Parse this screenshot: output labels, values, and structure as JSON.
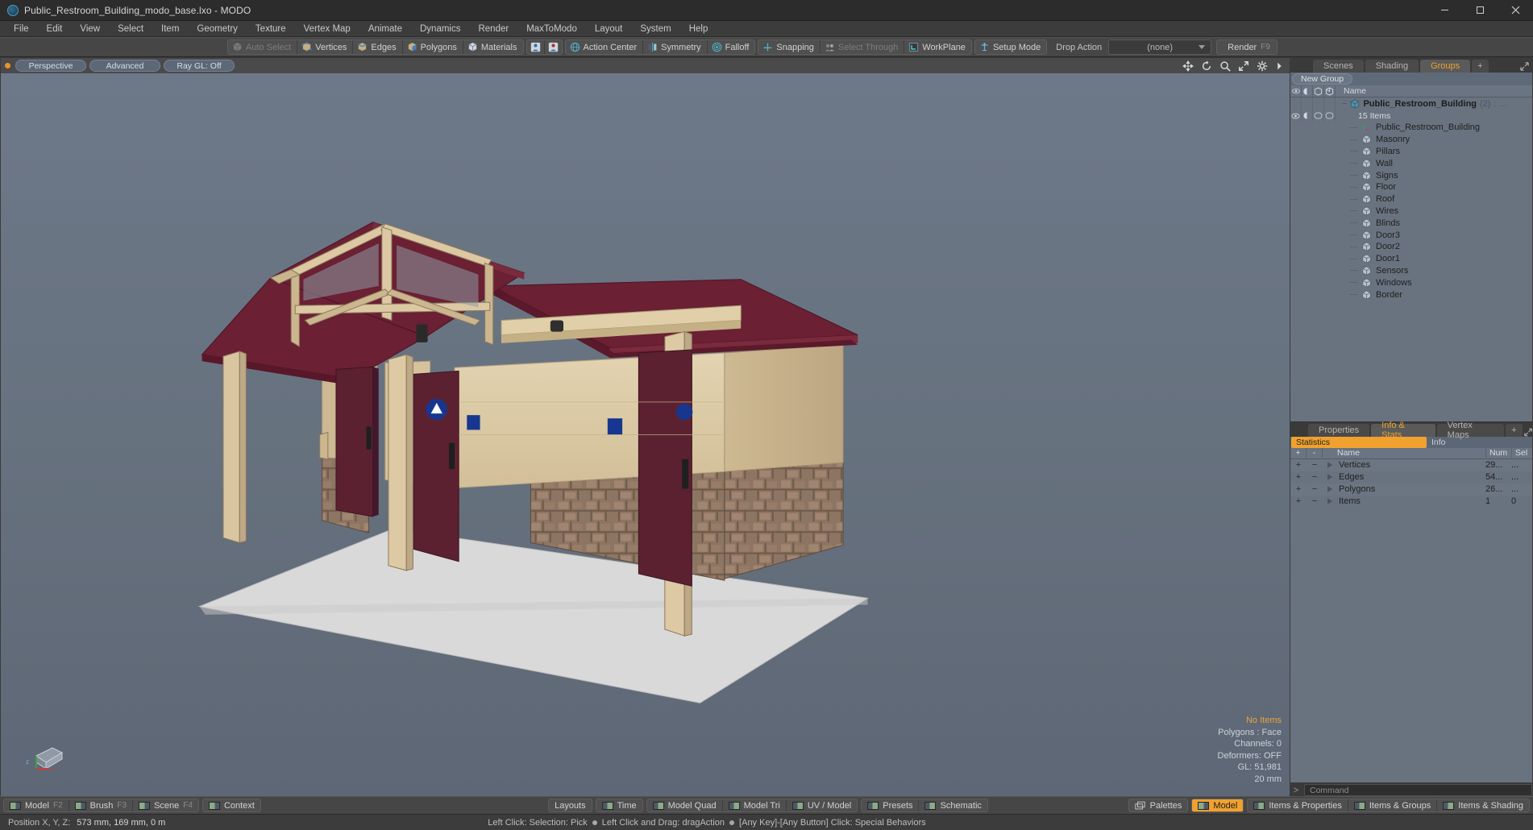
{
  "window": {
    "title": "Public_Restroom_Building_modo_base.lxo - MODO",
    "minimize": "minimize-icon",
    "maximize": "maximize-icon",
    "close": "close-icon"
  },
  "menubar": {
    "items": [
      "File",
      "Edit",
      "View",
      "Select",
      "Item",
      "Geometry",
      "Texture",
      "Vertex Map",
      "Animate",
      "Dynamics",
      "Render",
      "MaxToModo",
      "Layout",
      "System",
      "Help"
    ]
  },
  "toolbar": {
    "group1": [
      "Auto Select",
      "Vertices",
      "Edges",
      "Polygons",
      "Materials"
    ],
    "group2": [
      "Action Center",
      "Symmetry",
      "Falloff"
    ],
    "group3": [
      "Snapping",
      "Select Through",
      "WorkPlane"
    ],
    "group4": [
      "Setup Mode"
    ],
    "drop_action_label": "Drop Action",
    "drop_action_value": "(none)",
    "render_label": "Render",
    "render_key": "F9"
  },
  "viewport": {
    "tabs": [
      "Perspective",
      "Advanced",
      "Ray GL: Off"
    ],
    "corner_icons": [
      "pan-icon",
      "rotate-icon",
      "zoom-icon",
      "fit-icon",
      "gear-icon",
      "chevron-right-icon"
    ],
    "info": {
      "items": "No Items",
      "polygons": "Polygons : Face",
      "channels": "Channels: 0",
      "deformers": "Deformers: OFF",
      "gl": "GL: 51,981",
      "grid": "20 mm"
    },
    "axis": {
      "x": "x",
      "y": "y",
      "z": "z"
    }
  },
  "right_panel": {
    "tabs": [
      "Scenes",
      "Shading",
      "Groups"
    ],
    "active_tab": "Groups",
    "add_tab": "+",
    "new_group_button": "New Group",
    "name_column": "Name",
    "group": {
      "name": "Public_Restroom_Building",
      "count": "(2)",
      "trailing": ":",
      "ellipsis": "...",
      "subtitle": "15 Items"
    },
    "items": [
      {
        "label": "Public_Restroom_Building",
        "icon": "locator-icon"
      },
      {
        "label": "Masonry",
        "icon": "mesh-icon"
      },
      {
        "label": "Pillars",
        "icon": "mesh-icon"
      },
      {
        "label": "Wall",
        "icon": "mesh-icon"
      },
      {
        "label": "Signs",
        "icon": "mesh-icon"
      },
      {
        "label": "Floor",
        "icon": "mesh-icon"
      },
      {
        "label": "Roof",
        "icon": "mesh-icon"
      },
      {
        "label": "Wires",
        "icon": "mesh-icon"
      },
      {
        "label": "Blinds",
        "icon": "mesh-icon"
      },
      {
        "label": "Door3",
        "icon": "mesh-icon"
      },
      {
        "label": "Door2",
        "icon": "mesh-icon"
      },
      {
        "label": "Door1",
        "icon": "mesh-icon"
      },
      {
        "label": "Sensors",
        "icon": "mesh-icon"
      },
      {
        "label": "Windows",
        "icon": "mesh-icon"
      },
      {
        "label": "Border",
        "icon": "mesh-icon"
      }
    ]
  },
  "stats_panel": {
    "tabs": [
      "Properties",
      "Info & Stats",
      "Vertex Maps"
    ],
    "active_tab": "Info & Stats",
    "add_tab": "+",
    "subtabs": {
      "statistics": "Statistics",
      "info": "Info"
    },
    "columns": {
      "plus": "+",
      "minus": "-",
      "name": "Name",
      "num": "Num",
      "sel": "Sel"
    },
    "rows": [
      {
        "name": "Vertices",
        "num": "29...",
        "sel": "..."
      },
      {
        "name": "Edges",
        "num": "54...",
        "sel": "..."
      },
      {
        "name": "Polygons",
        "num": "26...",
        "sel": "..."
      },
      {
        "name": "Items",
        "num": "1",
        "sel": "0"
      }
    ],
    "command_prompt": ">",
    "command_placeholder": "Command"
  },
  "bottom_bar": {
    "left": [
      {
        "label": "Model",
        "key": "F2"
      },
      {
        "label": "Brush",
        "key": "F3"
      },
      {
        "label": "Scene",
        "key": "F4"
      }
    ],
    "context": "Context",
    "center": [
      "Layouts",
      "Time",
      "Model Quad",
      "Model Tri",
      "UV / Model",
      "Presets",
      "Schematic"
    ],
    "right": [
      "Palettes",
      "Model",
      "Items & Properties",
      "Items & Groups",
      "Items & Shading"
    ],
    "right_active": "Model"
  },
  "status_bar": {
    "position_label": "Position X, Y, Z:",
    "position_value": "573 mm, 169 mm, 0 m",
    "hint_left": "Left Click: Selection: Pick",
    "hint_mid": "Left Click and Drag: dragAction",
    "hint_right": "[Any Key]-[Any Button] Click: Special Behaviors"
  },
  "colors": {
    "accent": "#f0a12e",
    "panel": "#69737f",
    "chrome": "#464646",
    "viewport_sky": "#6d7889"
  }
}
